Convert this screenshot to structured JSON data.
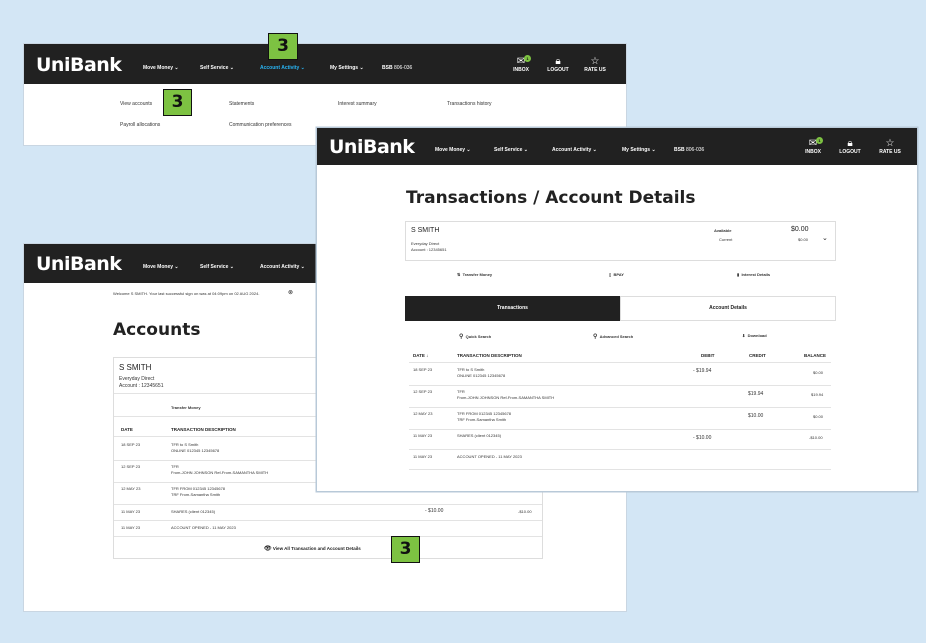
{
  "brand": {
    "logo": "UniBank",
    "accent": "#7dc242",
    "nav_bg": "#212121",
    "active_color": "#29b6f6"
  },
  "nav": {
    "move_money": "Move Money ⌄",
    "self_service": "Self Service ⌄",
    "account_activity": "Account Activity ⌄",
    "my_settings": "My Settings ⌄",
    "bsb_label": "BSB",
    "bsb_value": "806-036",
    "inbox": "INBOX",
    "logout": "LOGOUT",
    "rate_us": "RATE US",
    "inbox_count": "1"
  },
  "callout_number": "3",
  "dropdown": {
    "view_accounts": "View accounts",
    "statements": "Statements",
    "interest_summary": "Interest summary",
    "transactions_history": "Transactions history",
    "payroll_allocations": "Payroll allocations",
    "communication_preferences": "Communication preferences"
  },
  "accounts_panel": {
    "welcome": "Welcome S SMITH. Your last successful sign on was at 04:09pm on 02 AUG 2024.",
    "title": "Accounts",
    "name": "S SMITH",
    "account_type": "Everyday Direct",
    "account_number": "Account : 12345651",
    "transfer_money": "Transfer Money",
    "col_date": "DATE",
    "col_desc": "TRANSACTION DESCRIPTION",
    "rows": [
      {
        "date": "18 SEP 23",
        "desc1": "TFR to S Smith",
        "desc2": "ONLINE 012345 12345678",
        "debit": "",
        "balance": ""
      },
      {
        "date": "12 SEP 23",
        "desc1": "TFR",
        "desc2": "From-JOHN JOHNSON Ref-From-SAMANTHA SMITH",
        "debit": "",
        "balance": ""
      },
      {
        "date": "12 MAY 23",
        "desc1": "TFR FROM 012345 12345678",
        "desc2": "TRF From-Samantha Smith",
        "debit": "",
        "balance": ""
      },
      {
        "date": "11 MAY 23",
        "desc1": "SHARES (client 012345)",
        "desc2": "",
        "debit": "- $10.00",
        "balance": "-$10.00"
      },
      {
        "date": "11 MAY 23",
        "desc1": "ACCOUNT OPENED - 11 MAY 2023",
        "desc2": "",
        "debit": "",
        "balance": ""
      }
    ],
    "view_all": "View All Transaction and Account Details"
  },
  "details_panel": {
    "title": "Transactions / Account Details",
    "name": "S SMITH",
    "account_type": "Everyday Direct",
    "account_number": "Account : 12345651",
    "available_label": "Available",
    "available_value": "$0.00",
    "current_label": "Current",
    "current_value": "$0.00",
    "transfer_money": "Transfer Money",
    "bpay": "BPAY",
    "interest_details": "Interest Details",
    "tab_transactions": "Transactions",
    "tab_account_details": "Account Details",
    "quick_search": "Quick Search",
    "advanced_search": "Advanced Search",
    "download": "Download",
    "col_date": "DATE ↓",
    "col_desc": "TRANSACTION DESCRIPTION",
    "col_debit": "DEBIT",
    "col_credit": "CREDIT",
    "col_balance": "BALANCE",
    "rows": [
      {
        "date": "18 SEP 23",
        "desc1": "TFR to S Smith",
        "desc2": "ONLINE 012345 12345678",
        "debit": "- $19.94",
        "credit": "",
        "balance": "$0.00"
      },
      {
        "date": "12 SEP 23",
        "desc1": "TFR",
        "desc2": "From-JOHN JOHNSON Ref-From-SAMANTHA SMITH",
        "debit": "",
        "credit": "$19.94",
        "balance": "$19.94"
      },
      {
        "date": "12 MAY 23",
        "desc1": "TFR FROM 012345 12345678",
        "desc2": "TRF From-Samantha Smith",
        "debit": "",
        "credit": "$10.00",
        "balance": "$0.00"
      },
      {
        "date": "11 MAY 23",
        "desc1": "SHARES (client 012345)",
        "desc2": "",
        "debit": "- $10.00",
        "credit": "",
        "balance": "-$10.00"
      },
      {
        "date": "11 MAY 23",
        "desc1": "ACCOUNT OPENED - 11 MAY 2023",
        "desc2": "",
        "debit": "",
        "credit": "",
        "balance": ""
      }
    ]
  }
}
